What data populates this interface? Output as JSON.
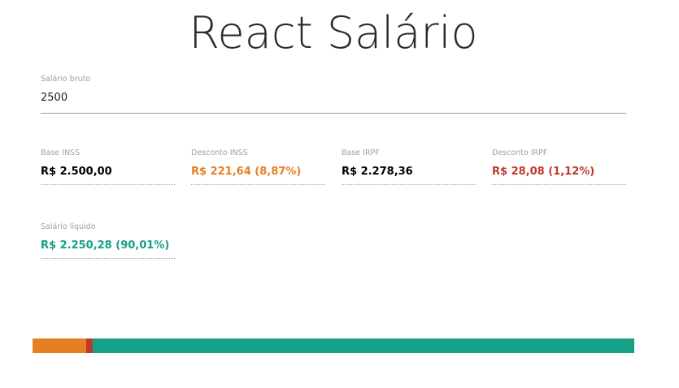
{
  "app": {
    "title": "React Salário"
  },
  "input": {
    "label": "Salário bruto",
    "value": "2500"
  },
  "fields": {
    "base_inss": {
      "label": "Base INSS",
      "value": "R$ 2.500,00",
      "color": "#000000"
    },
    "desconto_inss": {
      "label": "Desconto INSS",
      "value": "R$ 221,64 (8,87%)",
      "color": "#e67e22"
    },
    "base_irpf": {
      "label": "Base IRPF",
      "value": "R$ 2.278,36",
      "color": "#000000"
    },
    "desconto_irpf": {
      "label": "Desconto IRPF",
      "value": "R$ 28,08 (1,12%)",
      "color": "#c0392b"
    },
    "salario_liquido": {
      "label": "Salário líquido",
      "value": "R$ 2.250,28 (90,01%)",
      "color": "#16a085"
    }
  },
  "bar": {
    "segments": [
      {
        "name": "desconto-inss",
        "percent": 8.87,
        "color": "#e67e22"
      },
      {
        "name": "desconto-irpf",
        "percent": 1.12,
        "color": "#c0392b"
      },
      {
        "name": "salario-liquido",
        "percent": 90.01,
        "color": "#16a085"
      }
    ]
  }
}
